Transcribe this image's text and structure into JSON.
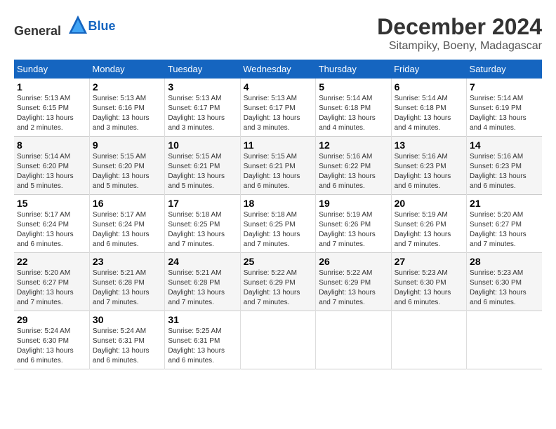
{
  "logo": {
    "general": "General",
    "blue": "Blue"
  },
  "title": {
    "month": "December 2024",
    "location": "Sitampiky, Boeny, Madagascar"
  },
  "weekdays": [
    "Sunday",
    "Monday",
    "Tuesday",
    "Wednesday",
    "Thursday",
    "Friday",
    "Saturday"
  ],
  "weeks": [
    [
      {
        "day": "1",
        "sunrise": "5:13 AM",
        "sunset": "6:15 PM",
        "daylight": "13 hours and 2 minutes."
      },
      {
        "day": "2",
        "sunrise": "5:13 AM",
        "sunset": "6:16 PM",
        "daylight": "13 hours and 3 minutes."
      },
      {
        "day": "3",
        "sunrise": "5:13 AM",
        "sunset": "6:17 PM",
        "daylight": "13 hours and 3 minutes."
      },
      {
        "day": "4",
        "sunrise": "5:13 AM",
        "sunset": "6:17 PM",
        "daylight": "13 hours and 3 minutes."
      },
      {
        "day": "5",
        "sunrise": "5:14 AM",
        "sunset": "6:18 PM",
        "daylight": "13 hours and 4 minutes."
      },
      {
        "day": "6",
        "sunrise": "5:14 AM",
        "sunset": "6:18 PM",
        "daylight": "13 hours and 4 minutes."
      },
      {
        "day": "7",
        "sunrise": "5:14 AM",
        "sunset": "6:19 PM",
        "daylight": "13 hours and 4 minutes."
      }
    ],
    [
      {
        "day": "8",
        "sunrise": "5:14 AM",
        "sunset": "6:20 PM",
        "daylight": "13 hours and 5 minutes."
      },
      {
        "day": "9",
        "sunrise": "5:15 AM",
        "sunset": "6:20 PM",
        "daylight": "13 hours and 5 minutes."
      },
      {
        "day": "10",
        "sunrise": "5:15 AM",
        "sunset": "6:21 PM",
        "daylight": "13 hours and 5 minutes."
      },
      {
        "day": "11",
        "sunrise": "5:15 AM",
        "sunset": "6:21 PM",
        "daylight": "13 hours and 6 minutes."
      },
      {
        "day": "12",
        "sunrise": "5:16 AM",
        "sunset": "6:22 PM",
        "daylight": "13 hours and 6 minutes."
      },
      {
        "day": "13",
        "sunrise": "5:16 AM",
        "sunset": "6:23 PM",
        "daylight": "13 hours and 6 minutes."
      },
      {
        "day": "14",
        "sunrise": "5:16 AM",
        "sunset": "6:23 PM",
        "daylight": "13 hours and 6 minutes."
      }
    ],
    [
      {
        "day": "15",
        "sunrise": "5:17 AM",
        "sunset": "6:24 PM",
        "daylight": "13 hours and 6 minutes."
      },
      {
        "day": "16",
        "sunrise": "5:17 AM",
        "sunset": "6:24 PM",
        "daylight": "13 hours and 6 minutes."
      },
      {
        "day": "17",
        "sunrise": "5:18 AM",
        "sunset": "6:25 PM",
        "daylight": "13 hours and 7 minutes."
      },
      {
        "day": "18",
        "sunrise": "5:18 AM",
        "sunset": "6:25 PM",
        "daylight": "13 hours and 7 minutes."
      },
      {
        "day": "19",
        "sunrise": "5:19 AM",
        "sunset": "6:26 PM",
        "daylight": "13 hours and 7 minutes."
      },
      {
        "day": "20",
        "sunrise": "5:19 AM",
        "sunset": "6:26 PM",
        "daylight": "13 hours and 7 minutes."
      },
      {
        "day": "21",
        "sunrise": "5:20 AM",
        "sunset": "6:27 PM",
        "daylight": "13 hours and 7 minutes."
      }
    ],
    [
      {
        "day": "22",
        "sunrise": "5:20 AM",
        "sunset": "6:27 PM",
        "daylight": "13 hours and 7 minutes."
      },
      {
        "day": "23",
        "sunrise": "5:21 AM",
        "sunset": "6:28 PM",
        "daylight": "13 hours and 7 minutes."
      },
      {
        "day": "24",
        "sunrise": "5:21 AM",
        "sunset": "6:28 PM",
        "daylight": "13 hours and 7 minutes."
      },
      {
        "day": "25",
        "sunrise": "5:22 AM",
        "sunset": "6:29 PM",
        "daylight": "13 hours and 7 minutes."
      },
      {
        "day": "26",
        "sunrise": "5:22 AM",
        "sunset": "6:29 PM",
        "daylight": "13 hours and 7 minutes."
      },
      {
        "day": "27",
        "sunrise": "5:23 AM",
        "sunset": "6:30 PM",
        "daylight": "13 hours and 6 minutes."
      },
      {
        "day": "28",
        "sunrise": "5:23 AM",
        "sunset": "6:30 PM",
        "daylight": "13 hours and 6 minutes."
      }
    ],
    [
      {
        "day": "29",
        "sunrise": "5:24 AM",
        "sunset": "6:30 PM",
        "daylight": "13 hours and 6 minutes."
      },
      {
        "day": "30",
        "sunrise": "5:24 AM",
        "sunset": "6:31 PM",
        "daylight": "13 hours and 6 minutes."
      },
      {
        "day": "31",
        "sunrise": "5:25 AM",
        "sunset": "6:31 PM",
        "daylight": "13 hours and 6 minutes."
      },
      null,
      null,
      null,
      null
    ]
  ]
}
